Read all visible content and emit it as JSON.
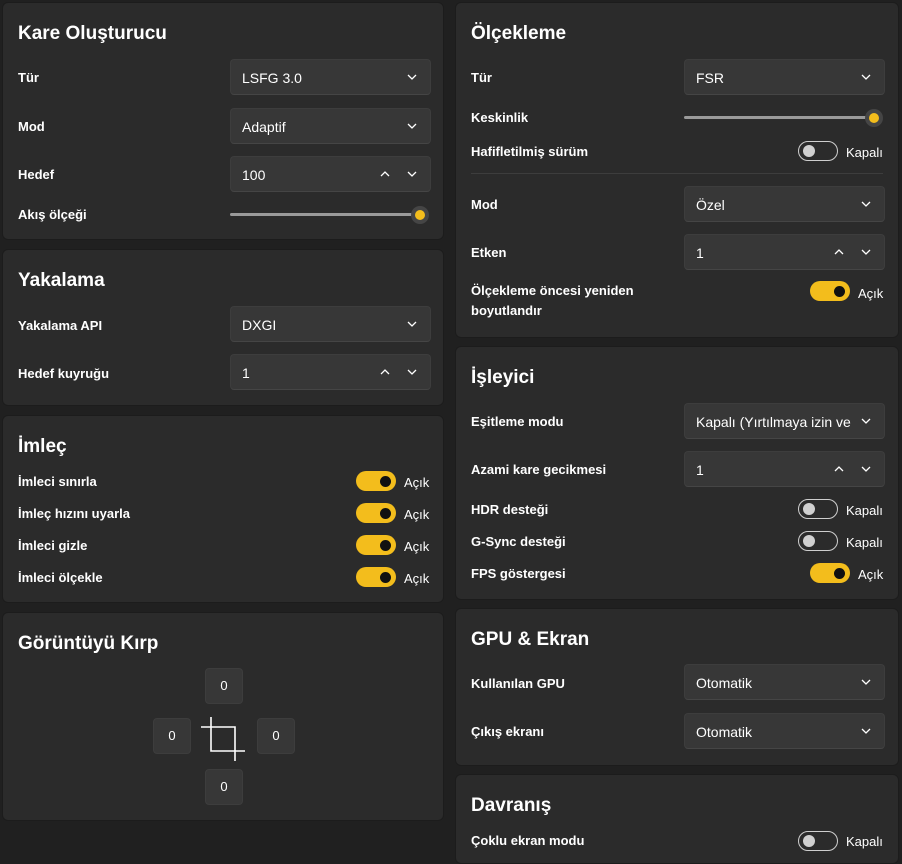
{
  "frame_gen": {
    "title": "Kare Oluşturucu",
    "type_label": "Tür",
    "type_value": "LSFG 3.0",
    "mode_label": "Mod",
    "mode_value": "Adaptif",
    "target_label": "Hedef",
    "target_value": "100",
    "flow_scale_label": "Akış ölçeği",
    "flow_scale_level": 1.0
  },
  "capture": {
    "title": "Yakalama",
    "api_label": "Yakalama API",
    "api_value": "DXGI",
    "queue_label": "Hedef kuyruğu",
    "queue_value": "1"
  },
  "cursor": {
    "title": "İmleç",
    "items": [
      {
        "label": "İmleci sınırla",
        "state": "Açık",
        "on": true
      },
      {
        "label": "İmleç hızını uyarla",
        "state": "Açık",
        "on": true
      },
      {
        "label": "İmleci gizle",
        "state": "Açık",
        "on": true
      },
      {
        "label": "İmleci ölçekle",
        "state": "Açık",
        "on": true
      }
    ]
  },
  "crop": {
    "title": "Görüntüyü Kırp",
    "top": "0",
    "left": "0",
    "right": "0",
    "bottom": "0"
  },
  "scaling": {
    "title": "Ölçekleme",
    "type_label": "Tür",
    "type_value": "FSR",
    "sharpness_label": "Keskinlik",
    "sharpness_level": 1.0,
    "lite_label": "Hafifletilmiş sürüm",
    "lite_state": "Kapalı",
    "lite_on": false,
    "mode_label": "Mod",
    "mode_value": "Özel",
    "factor_label": "Etken",
    "factor_value": "1",
    "prescale_label": "Ölçekleme öncesi yeniden boyutlandır",
    "prescale_state": "Açık",
    "prescale_on": true
  },
  "renderer": {
    "title": "İşleyici",
    "vsync_label": "Eşitleme modu",
    "vsync_value": "Kapalı (Yırtılmaya izin ve",
    "latency_label": "Azami kare gecikmesi",
    "latency_value": "1",
    "toggles": [
      {
        "label": "HDR desteği",
        "state": "Kapalı",
        "on": false
      },
      {
        "label": "G-Sync desteği",
        "state": "Kapalı",
        "on": false
      },
      {
        "label": "FPS göstergesi",
        "state": "Açık",
        "on": true
      }
    ]
  },
  "gpu": {
    "title": "GPU & Ekran",
    "gpu_label": "Kullanılan GPU",
    "gpu_value": "Otomatik",
    "display_label": "Çıkış ekranı",
    "display_value": "Otomatik"
  },
  "behavior": {
    "title": "Davranış",
    "multi_label": "Çoklu ekran modu",
    "multi_state": "Kapalı",
    "multi_on": false
  },
  "colors": {
    "accent": "#f3bd1c",
    "card": "#2b2b2b",
    "background": "#202020",
    "control": "#373737"
  }
}
